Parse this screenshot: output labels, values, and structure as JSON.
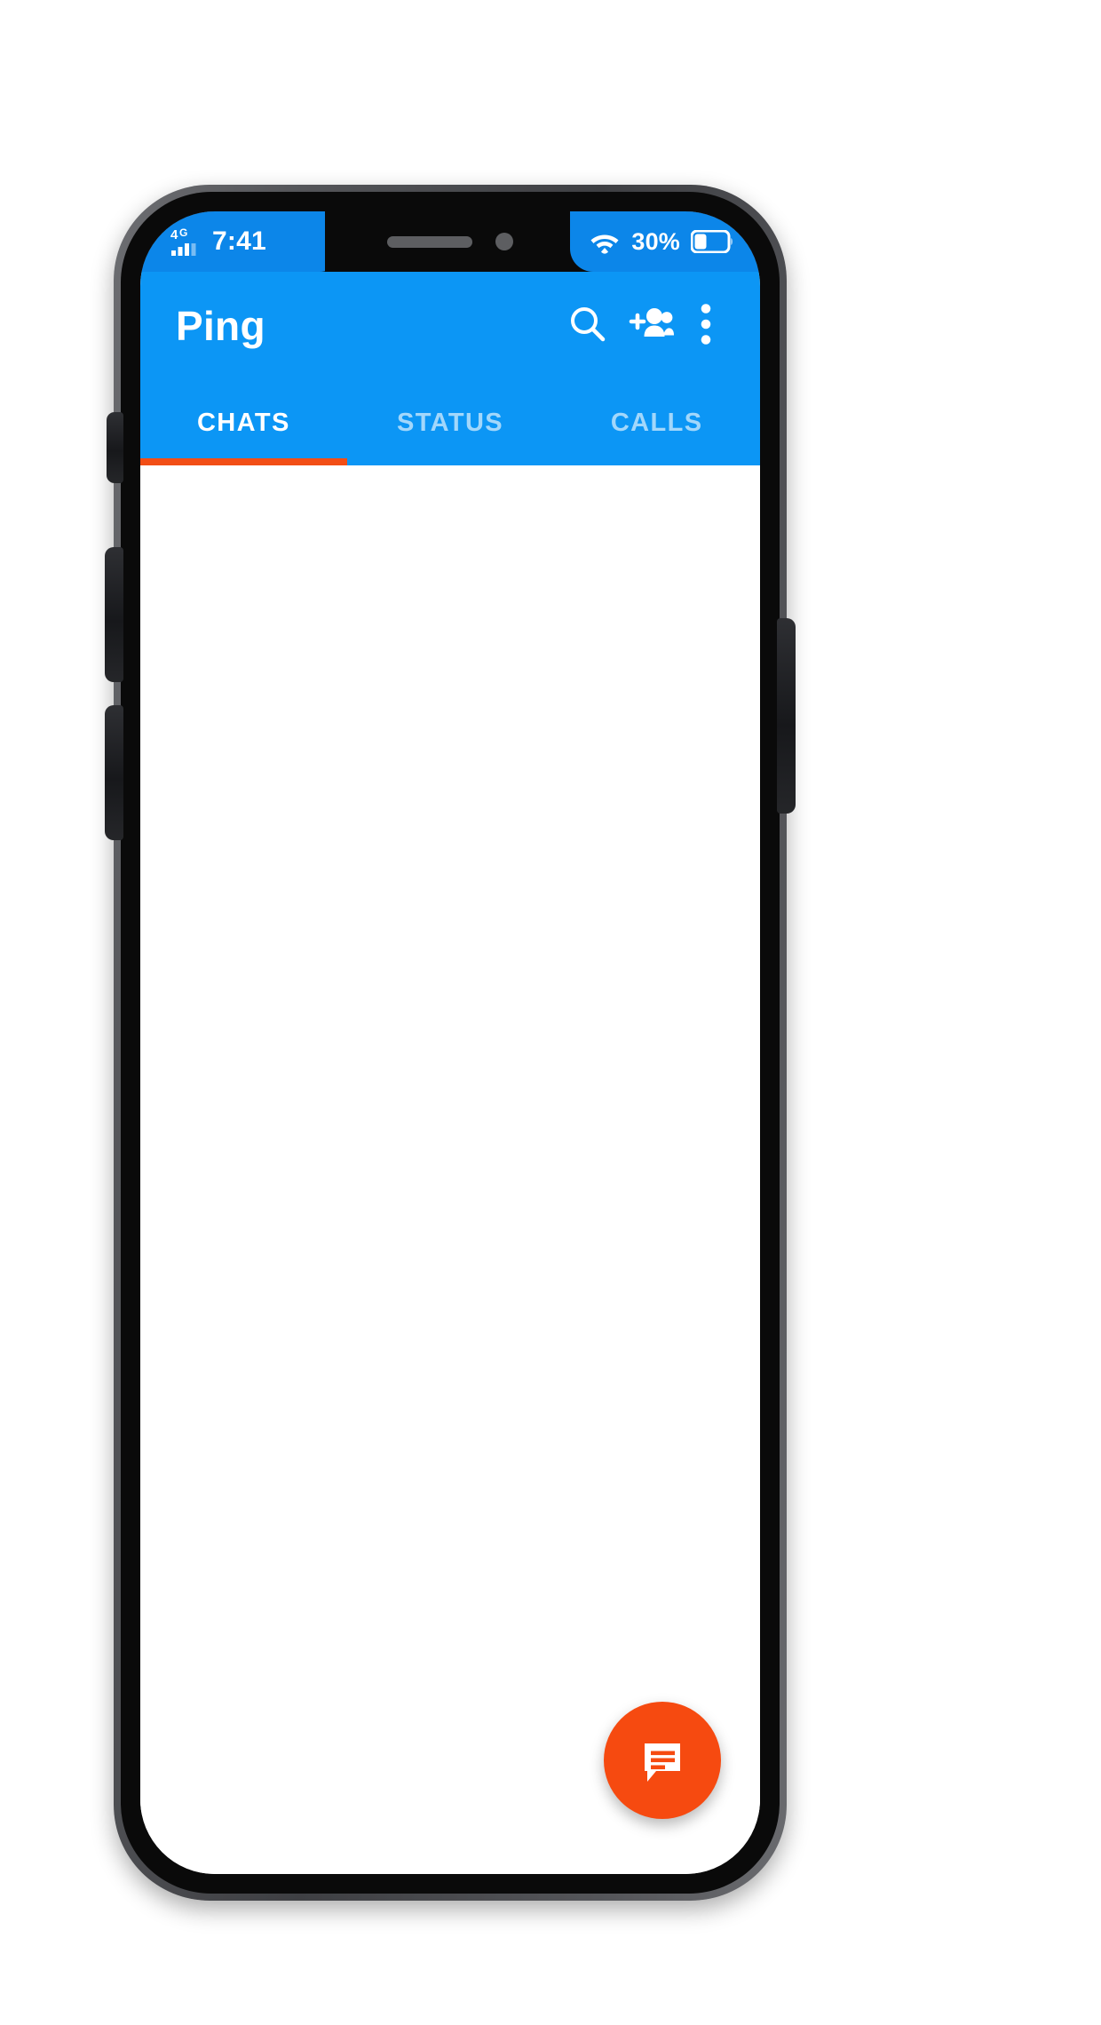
{
  "device": {
    "kind": "smartphone-mockup",
    "buttons": [
      {
        "name": "silent-switch"
      },
      {
        "name": "volume-up-button"
      },
      {
        "name": "volume-down-button"
      },
      {
        "name": "power-button"
      }
    ],
    "notch": {
      "speaker": "speaker-grille",
      "camera": "front-camera"
    }
  },
  "status_bar": {
    "network_type": "4G",
    "signal_icon": "signal-bars-icon",
    "time": "7:41",
    "wifi_icon": "wifi-icon",
    "battery_percent": "30%",
    "battery_icon": "battery-icon",
    "battery_level": 30,
    "background_color": "#0c86e9",
    "text_color": "#ffffff"
  },
  "app_bar": {
    "title": "Ping",
    "background_color": "#0c96f5",
    "actions": [
      {
        "name": "search-icon",
        "label": "Search"
      },
      {
        "name": "add-people-icon",
        "label": "New group"
      },
      {
        "name": "overflow-menu-icon",
        "label": "More options"
      }
    ]
  },
  "tabs": {
    "items": [
      {
        "label": "CHATS",
        "active": true
      },
      {
        "label": "STATUS",
        "active": false
      },
      {
        "label": "CALLS",
        "active": false
      }
    ],
    "indicator_color": "#f24e16",
    "active_text_color": "#ffffff",
    "inactive_text_color": "rgba(255,255,255,0.62)"
  },
  "chat_list": {
    "items": [],
    "empty": true,
    "background_color": "#ffffff"
  },
  "fab": {
    "name": "new-chat-fab",
    "label": "New chat",
    "icon": "chat-bubble-icon",
    "background_color": "#f64a10",
    "icon_color": "#ffffff"
  }
}
